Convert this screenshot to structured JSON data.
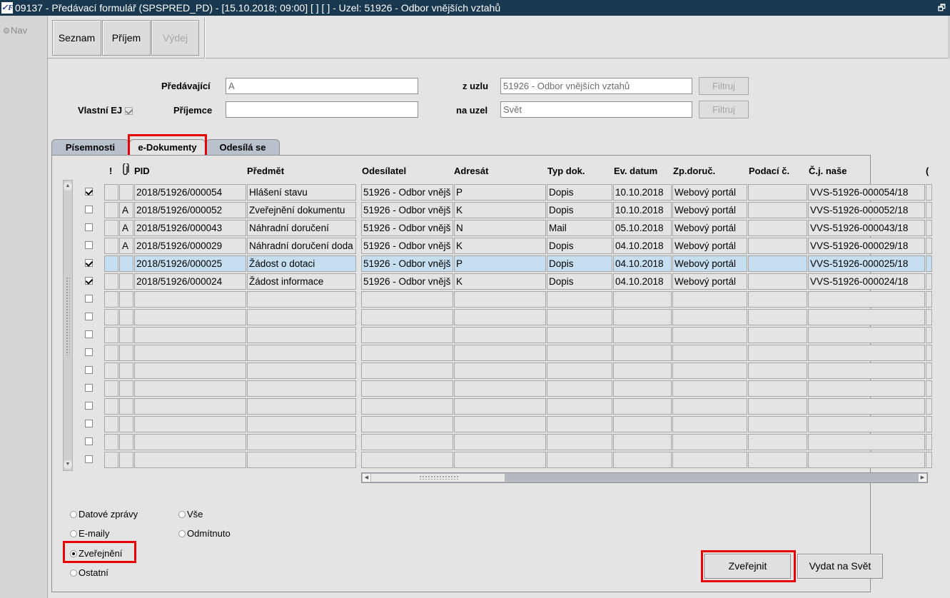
{
  "window": {
    "title": "09137 - Předávací formulář (SPSPRED_PD) - [15.10.2018; 09:00]  [ ]  [ ] - Uzel: 51926 - Odbor vnějších vztahů",
    "app_icon": "✓F",
    "restore_glyph": "🗗"
  },
  "nav": {
    "label": "Nav"
  },
  "toolbar": {
    "seznam": "Seznam",
    "prijem": "Příjem",
    "vydej": "Výdej"
  },
  "filter": {
    "predavajici_label": "Předávající",
    "predavajici_value": "A",
    "prijemce_label": "Příjemce",
    "prijemce_value": "",
    "vlastni_ej_label": "Vlastní EJ",
    "vlastni_ej_checked": true,
    "z_uzlu_label": "z uzlu",
    "z_uzlu_value": "51926 - Odbor vnějších vztahů",
    "na_uzel_label": "na uzel",
    "na_uzel_value": "Svět",
    "filtruj": "Filtruj"
  },
  "tabs": [
    "Písemnosti",
    "e-Dokumenty",
    "Odesílá se"
  ],
  "active_tab": "e-Dokumenty",
  "table": {
    "headers": {
      "excl": "!",
      "attach": "📎",
      "pid": "PID",
      "predmet": "Předmět",
      "odesilatel": "Odesílatel",
      "adresat": "Adresát",
      "typ": "Typ dok.",
      "datum": "Ev. datum",
      "zpdoruc": "Zp.doruč.",
      "podaci": "Podací č.",
      "cj": "Č.j. naše",
      "more": "("
    },
    "rows": [
      {
        "checked": true,
        "excl": "",
        "attach": "",
        "pid": "2018/51926/000054",
        "predmet": "Hlášení stavu",
        "odesilatel": "51926 - Odbor vnějš",
        "adresat": "P",
        "typ": "Dopis",
        "datum": "10.10.2018",
        "zpdoruc": "Webový portál",
        "podaci": "",
        "cj": "VVS-51926-000054/18",
        "selected": false
      },
      {
        "checked": false,
        "excl": "",
        "attach": "A",
        "pid": "2018/51926/000052",
        "predmet": "Zveřejnění dokumentu",
        "odesilatel": "51926 - Odbor vnějš",
        "adresat": "K",
        "typ": "Dopis",
        "datum": "10.10.2018",
        "zpdoruc": "Webový portál",
        "podaci": "",
        "cj": "VVS-51926-000052/18",
        "selected": false
      },
      {
        "checked": false,
        "excl": "",
        "attach": "A",
        "pid": "2018/51926/000043",
        "predmet": "Náhradní doručení",
        "odesilatel": "51926 - Odbor vnějš",
        "adresat": "N",
        "typ": "Mail",
        "datum": "05.10.2018",
        "zpdoruc": "Webový portál",
        "podaci": "",
        "cj": "VVS-51926-000043/18",
        "selected": false
      },
      {
        "checked": false,
        "excl": "",
        "attach": "A",
        "pid": "2018/51926/000029",
        "predmet": "Náhradní doručení doda",
        "odesilatel": "51926 - Odbor vnějš",
        "adresat": "K",
        "typ": "Dopis",
        "datum": "04.10.2018",
        "zpdoruc": "Webový portál",
        "podaci": "",
        "cj": "VVS-51926-000029/18",
        "selected": false
      },
      {
        "checked": true,
        "excl": "",
        "attach": "",
        "pid": "2018/51926/000025",
        "predmet": "Žádost o dotaci",
        "odesilatel": "51926 - Odbor vnějš",
        "adresat": "P",
        "typ": "Dopis",
        "datum": "04.10.2018",
        "zpdoruc": "Webový portál",
        "podaci": "",
        "cj": "VVS-51926-000025/18",
        "selected": true
      },
      {
        "checked": true,
        "excl": "",
        "attach": "",
        "pid": "2018/51926/000024",
        "predmet": "Žádost informace",
        "odesilatel": "51926 - Odbor vnějš",
        "adresat": "K",
        "typ": "Dopis",
        "datum": "04.10.2018",
        "zpdoruc": "Webový portál",
        "podaci": "",
        "cj": "VVS-51926-000024/18",
        "selected": false
      }
    ],
    "empty_rows": 10
  },
  "radios": {
    "datove_zpravy": "Datové zprávy",
    "e_maily": "E-maily",
    "zverejneni": "Zveřejnění",
    "ostatni": "Ostatní",
    "vse": "Vše",
    "odmitnuto": "Odmítnuto",
    "selected": "zverejneni"
  },
  "actions": {
    "zverejnit": "Zveřejnit",
    "vydat_na_svet": "Vydat na Svět"
  },
  "colors": {
    "titlebar": "#18384f",
    "highlight_box": "#e60000",
    "selected_row": "#c5dff0",
    "tab_inactive": "#b9c2cc"
  }
}
